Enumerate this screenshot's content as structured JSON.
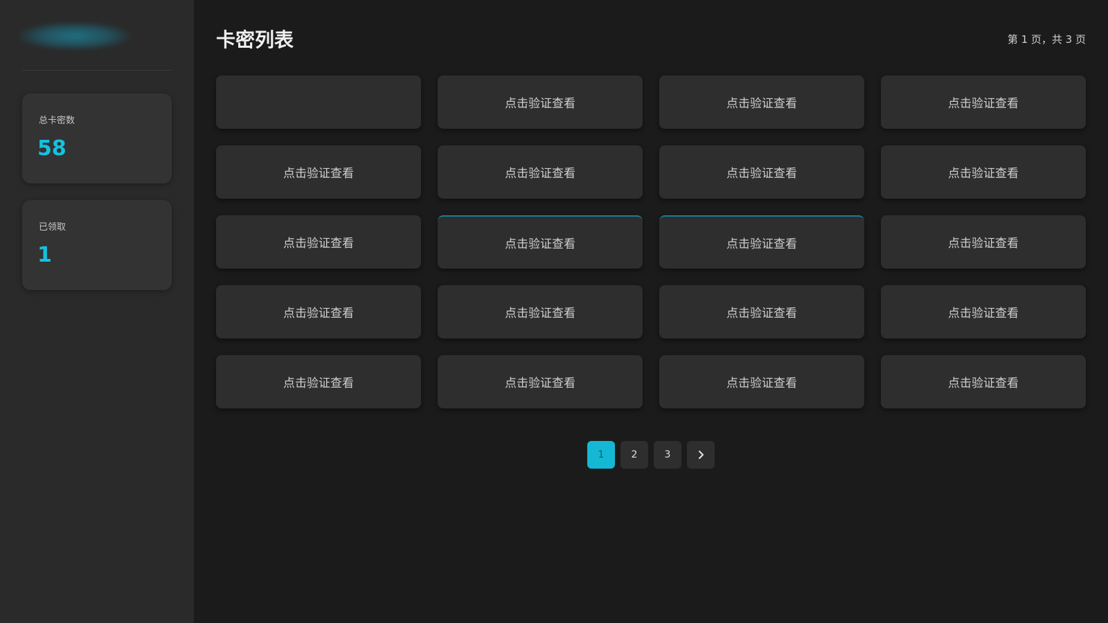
{
  "sidebar": {
    "brand": "",
    "stats": [
      {
        "label": "总卡密数",
        "value": "58"
      },
      {
        "label": "已领取",
        "value": "1"
      }
    ]
  },
  "main": {
    "title": "卡密列表",
    "page_info": "第 1 页，共 3 页",
    "cards": [
      {
        "label": "",
        "blurred": true
      },
      {
        "label": "点击验证查看"
      },
      {
        "label": "点击验证查看"
      },
      {
        "label": "点击验证查看"
      },
      {
        "label": "点击验证查看"
      },
      {
        "label": "点击验证查看"
      },
      {
        "label": "点击验证查看"
      },
      {
        "label": "点击验证查看"
      },
      {
        "label": "点击验证查看"
      },
      {
        "label": "点击验证查看"
      },
      {
        "label": "点击验证查看"
      },
      {
        "label": "点击验证查看"
      },
      {
        "label": "点击验证查看"
      },
      {
        "label": "点击验证查看"
      },
      {
        "label": "点击验证查看"
      },
      {
        "label": "点击验证查看"
      },
      {
        "label": "点击验证查看"
      },
      {
        "label": "点击验证查看"
      },
      {
        "label": "点击验证查看"
      },
      {
        "label": "点击验证查看"
      }
    ],
    "pagination": {
      "pages": [
        "1",
        "2",
        "3"
      ],
      "current": "1",
      "next_icon": "chevron-right-icon"
    }
  },
  "colors": {
    "accent": "#14c2e0",
    "background": "#1b1b1b",
    "sidebar": "#2a2a2a",
    "card": "#2e2e2e"
  }
}
